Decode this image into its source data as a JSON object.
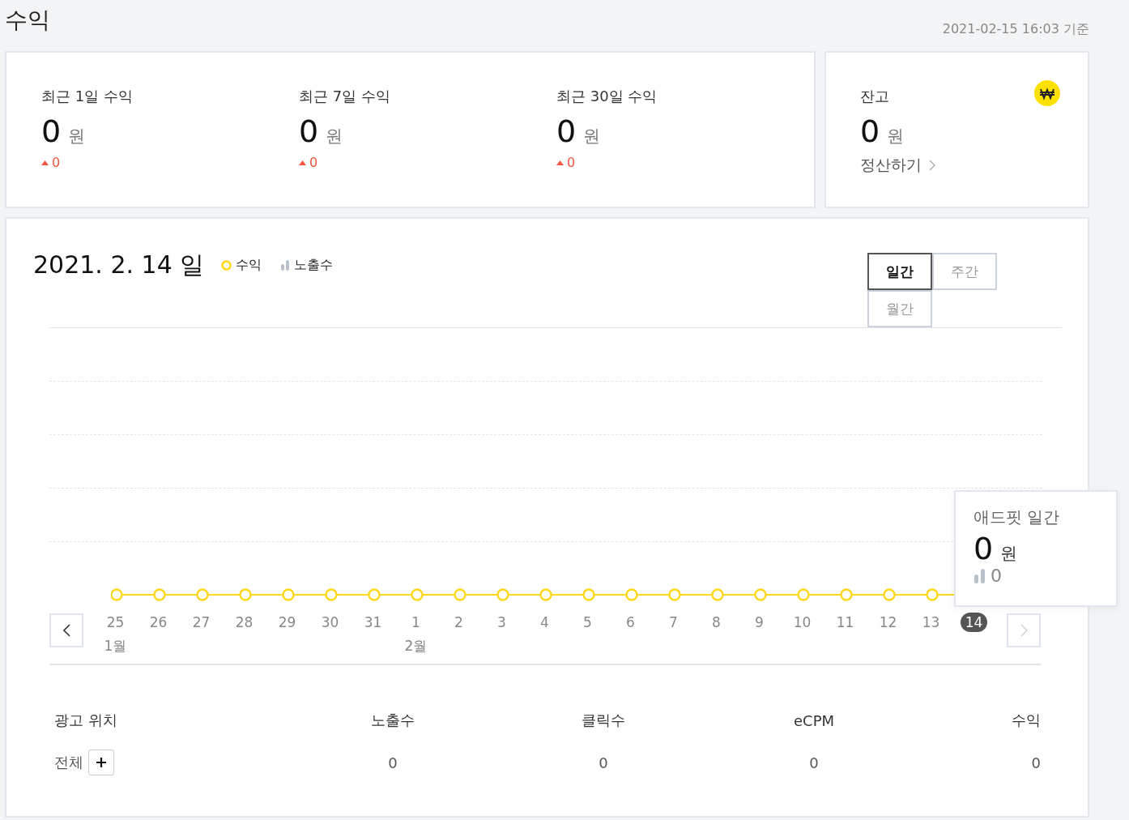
{
  "page": {
    "title": "수익",
    "updated": "2021-02-15 16:03 기준"
  },
  "summary": [
    {
      "label": "최근 1일 수익",
      "amount": "0",
      "unit": "원",
      "change": "0",
      "rising": true
    },
    {
      "label": "최근 7일 수익",
      "amount": "0",
      "unit": "원",
      "change": "0",
      "rising": true
    },
    {
      "label": "최근 30일 수익",
      "amount": "0",
      "unit": "원",
      "change": "0",
      "rising": true
    }
  ],
  "balance": {
    "label": "잔고",
    "amount": "0",
    "unit": "원",
    "link": "정산하기"
  },
  "chart": {
    "date": "2021. 2. 14 일",
    "legend": [
      {
        "label": "수익",
        "kind": "ring"
      },
      {
        "label": "노출수",
        "kind": "bars"
      }
    ],
    "periods": [
      {
        "label": "일간",
        "selected": true
      },
      {
        "label": "주간",
        "selected": false
      },
      {
        "label": "월간",
        "selected": false
      }
    ],
    "days": [
      {
        "day": "25",
        "month": "1월",
        "selected": false
      },
      {
        "day": "26",
        "selected": false
      },
      {
        "day": "27",
        "selected": false
      },
      {
        "day": "28",
        "selected": false
      },
      {
        "day": "29",
        "selected": false
      },
      {
        "day": "30",
        "selected": false
      },
      {
        "day": "31",
        "selected": false
      },
      {
        "day": "1",
        "month": "2월",
        "selected": false
      },
      {
        "day": "2",
        "selected": false
      },
      {
        "day": "3",
        "selected": false
      },
      {
        "day": "4",
        "selected": false
      },
      {
        "day": "5",
        "selected": false
      },
      {
        "day": "6",
        "selected": false
      },
      {
        "day": "7",
        "selected": false
      },
      {
        "day": "8",
        "selected": false
      },
      {
        "day": "9",
        "selected": false
      },
      {
        "day": "10",
        "selected": false
      },
      {
        "day": "11",
        "selected": false
      },
      {
        "day": "12",
        "selected": false
      },
      {
        "day": "13",
        "selected": false
      },
      {
        "day": "14",
        "selected": true
      }
    ],
    "tooltip": {
      "title": "애드핏 일간",
      "amount": "0",
      "unit": "원",
      "impressions": "0"
    }
  },
  "table": {
    "columns": [
      "광고 위치",
      "노출수",
      "클릭수",
      "eCPM",
      "수익"
    ],
    "rows": [
      {
        "cells": [
          "전체",
          "0",
          "0",
          "0",
          "0"
        ],
        "expandable": true
      }
    ]
  }
}
